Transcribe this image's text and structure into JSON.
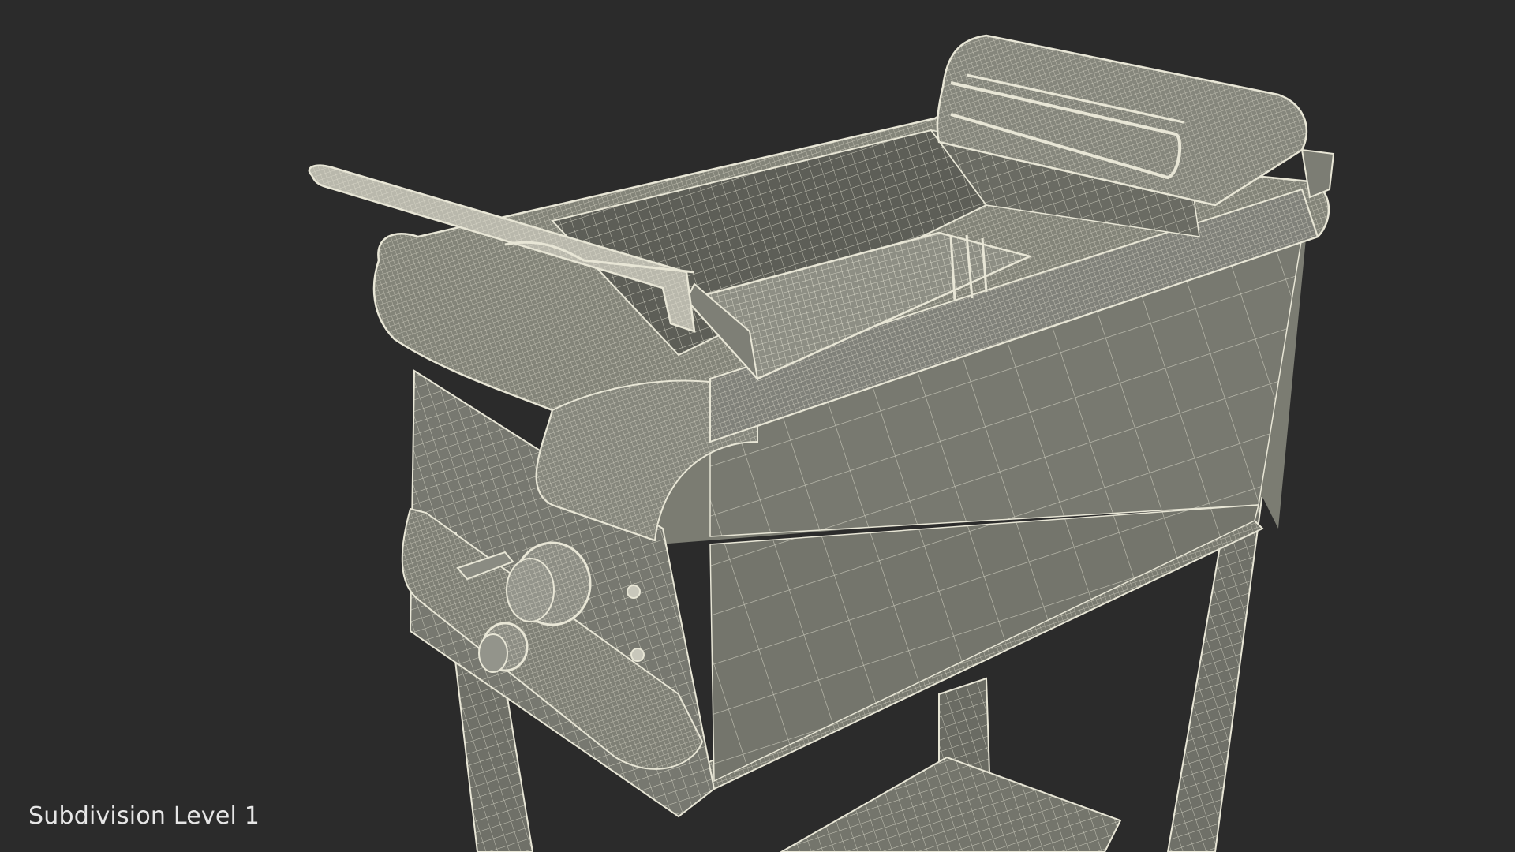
{
  "viewport": {
    "caption": "Subdivision Level 1",
    "background_color": "#2b2b2b",
    "wire_color": "#e8e6d6",
    "surface_color": "#7b7c72"
  }
}
